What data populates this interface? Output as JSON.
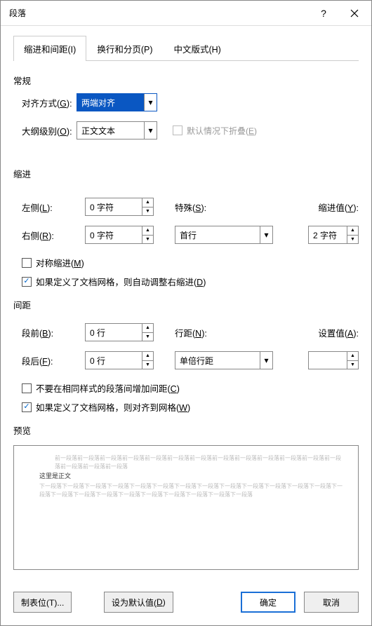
{
  "title": "段落",
  "tabs": [
    "缩进和间距(I)",
    "换行和分页(P)",
    "中文版式(H)"
  ],
  "activeTab": 0,
  "sections": {
    "general": "常规",
    "indent": "缩进",
    "spacing": "间距",
    "preview": "预览"
  },
  "general": {
    "alignment_label": "对齐方式(G):",
    "alignment_value": "两端对齐",
    "outline_label": "大纲级别(O):",
    "outline_value": "正文文本",
    "collapse_label": "默认情况下折叠(E)",
    "collapse_checked": false,
    "collapse_disabled": true
  },
  "indent": {
    "left_label": "左侧(L):",
    "left_value": "0 字符",
    "right_label": "右侧(R):",
    "right_value": "0 字符",
    "special_label": "特殊(S):",
    "special_value": "首行",
    "by_label": "缩进值(Y):",
    "by_value": "2 字符",
    "mirror_label": "对称缩进(M)",
    "mirror_checked": false,
    "grid_label": "如果定义了文档网格，则自动调整右缩进(D)",
    "grid_checked": true
  },
  "spacing": {
    "before_label": "段前(B):",
    "before_value": "0 行",
    "after_label": "段后(F):",
    "after_value": "0 行",
    "line_label": "行距(N):",
    "line_value": "单倍行距",
    "at_label": "设置值(A):",
    "at_value": "",
    "nosame_label": "不要在相同样式的段落间增加间距(C)",
    "nosame_checked": false,
    "snap_label": "如果定义了文档网格，则对齐到网格(W)",
    "snap_checked": true
  },
  "preview": {
    "prev_text": "前一段落前一段落前一段落前一段落前一段落前一段落前一段落前一段落前一段落前一段落前一段落前一段落前一段落前一段落前一段落前一段落",
    "body_text": "这里是正文",
    "next_text": "下一段落下一段落下一段落下一段落下一段落下一段落下一段落下一段落下一段落下一段落下一段落下一段落下一段落下一段落下一段落下一段落下一段落下一段落下一段落下一段落下一段落下一段落下一段落"
  },
  "footer": {
    "tabs_btn": "制表位(T)...",
    "default_btn": "设为默认值(D)",
    "ok_btn": "确定",
    "cancel_btn": "取消"
  }
}
